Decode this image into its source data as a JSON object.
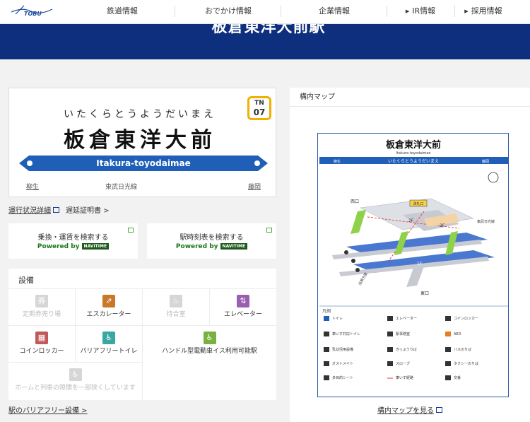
{
  "header": {
    "logo": "TOBU",
    "nav": [
      {
        "label": "鉄道情報",
        "arrow": false
      },
      {
        "label": "おでかけ情報",
        "arrow": false
      },
      {
        "label": "企業情報",
        "arrow": false
      },
      {
        "label": "IR情報",
        "arrow": true
      },
      {
        "label": "採用情報",
        "arrow": true
      }
    ],
    "banner_title": "板倉東洋大前駅"
  },
  "sign": {
    "kana": "いたくらとうようだいまえ",
    "kanji": "板倉東洋大前",
    "number_line": "TN",
    "number": "07",
    "romaji": "Itakura-toyodaimae",
    "prev": "柳生",
    "line": "東武日光線",
    "next": "藤岡"
  },
  "links": {
    "operation": "運行状況詳細",
    "delay_cert": "遅延証明書 >"
  },
  "search": [
    {
      "title": "乗換・運賃を検索する",
      "powered": "Powered by",
      "brand": "NAVITIME"
    },
    {
      "title": "駅時刻表を検索する",
      "powered": "Powered by",
      "brand": "NAVITIME"
    }
  ],
  "facilities": {
    "title": "設備",
    "items": [
      {
        "label": "定期券売り場",
        "enabled": false,
        "icon": "ticket-office-icon",
        "glyph": "券",
        "color": "#d6d6d6"
      },
      {
        "label": "エスカレーター",
        "enabled": true,
        "icon": "escalator-icon",
        "glyph": "⇗",
        "color": "#c8782a"
      },
      {
        "label": "待合室",
        "enabled": false,
        "icon": "waiting-room-icon",
        "glyph": "♨",
        "color": "#d6d6d6"
      },
      {
        "label": "エレベーター",
        "enabled": true,
        "icon": "elevator-icon",
        "glyph": "⇅",
        "color": "#9a5fb0"
      },
      {
        "label": "コインロッカー",
        "enabled": true,
        "icon": "coin-locker-icon",
        "glyph": "▦",
        "color": "#c05a5a"
      },
      {
        "label": "バリアフリートイレ",
        "enabled": true,
        "icon": "accessible-toilet-icon",
        "glyph": "♿",
        "color": "#3aa7a0"
      },
      {
        "label": "ハンドル型電動車イス利用可能駅",
        "enabled": true,
        "icon": "electric-wheelchair-icon",
        "glyph": "♿",
        "color": "#7ab040"
      },
      {
        "label": "ホームと列車の隙間を一部狭くしています",
        "enabled": false,
        "icon": "platform-gap-icon",
        "glyph": "♿",
        "color": "#d6d6d6"
      }
    ],
    "barrier_free_link": "駅のバリアフリー設備 >"
  },
  "map": {
    "title": "構内マップ",
    "map_title": "板倉東洋大前",
    "map_roma": "Itakura-toyodaimae",
    "map_kana": "いたくらとうようだいまえ",
    "prev": "柳生",
    "next": "藤岡",
    "west_exit": "西口",
    "east_exit": "東口",
    "ticket_gate": "改札口",
    "floor_1f": "1F",
    "floor_2f": "2F",
    "line_right": "東武日光線",
    "line_left": "浅草方面",
    "legend_title": "凡例",
    "legend": [
      "トイレ",
      "エレベーター",
      "コインロッカー",
      "車いす対応トイレ",
      "駅事務室",
      "AED",
      "乳幼児用設備",
      "きっぷうりば",
      "バスのりば",
      "オストメイト",
      "スロープ",
      "タクシーのりば",
      "多目的シート",
      "車いす経路",
      "交番"
    ],
    "link": "構内マップを見る"
  }
}
